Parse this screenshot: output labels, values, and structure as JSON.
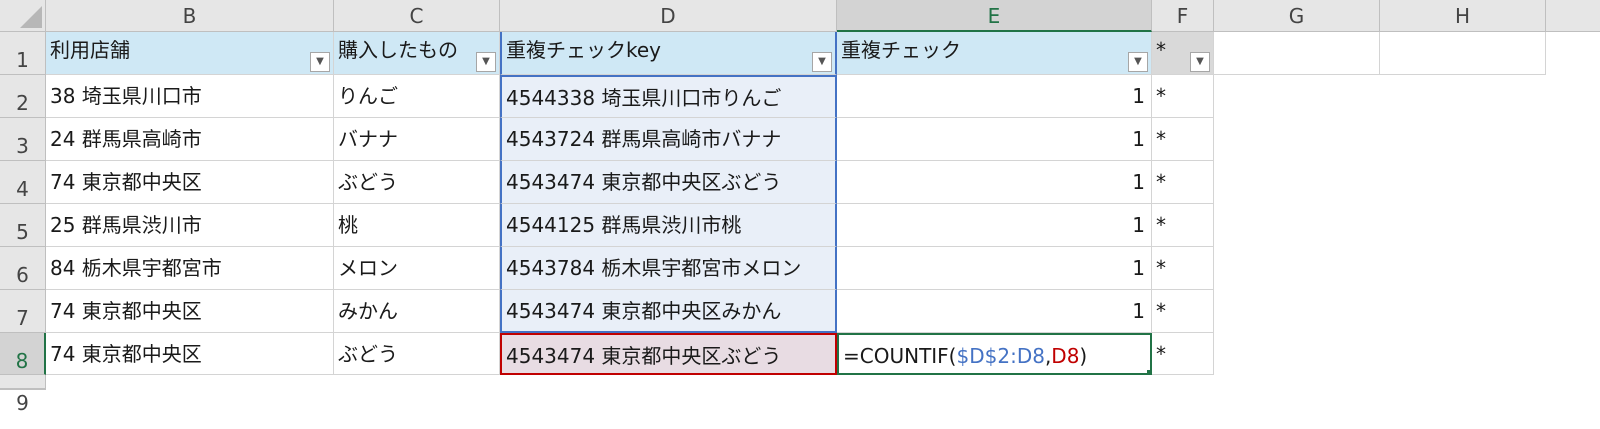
{
  "columns": [
    "B",
    "C",
    "D",
    "E",
    "F",
    "G",
    "H"
  ],
  "active_column": "E",
  "rows": [
    "1",
    "2",
    "3",
    "4",
    "5",
    "6",
    "7",
    "8",
    "9"
  ],
  "active_row": "8",
  "headers": {
    "b": "利用店舗",
    "c": "購入したもの",
    "d": "重複チェックkey",
    "e": "重複チェック",
    "f": "*"
  },
  "filter_icon": "filter-dropdown-icon",
  "data": [
    {
      "b": "38 埼玉県川口市",
      "c": "りんご",
      "d": "4544338 埼玉県川口市りんご",
      "e": "1",
      "f": "*"
    },
    {
      "b": "24 群馬県高崎市",
      "c": "バナナ",
      "d": "4543724 群馬県高崎市バナナ",
      "e": "1",
      "f": "*"
    },
    {
      "b": "74 東京都中央区",
      "c": "ぶどう",
      "d": "4543474 東京都中央区ぶどう",
      "e": "1",
      "f": "*"
    },
    {
      "b": "25 群馬県渋川市",
      "c": "桃",
      "d": "4544125 群馬県渋川市桃",
      "e": "1",
      "f": "*"
    },
    {
      "b": "84 栃木県宇都宮市",
      "c": "メロン",
      "d": "4543784 栃木県宇都宮市メロン",
      "e": "1",
      "f": "*"
    },
    {
      "b": "74 東京都中央区",
      "c": "みかん",
      "d": "4543474 東京都中央区みかん",
      "e": "1",
      "f": "*"
    },
    {
      "b": "74 東京都中央区",
      "c": "ぶどう",
      "d": "4543474 東京都中央区ぶどう",
      "f": "*"
    }
  ],
  "formula": {
    "prefix": "=COUNTIF(",
    "range": "$D$2:D8",
    "comma": ",",
    "ref": "D8",
    "suffix": ")"
  },
  "colors": {
    "header_fill": "#cfe8f5",
    "range_highlight": "#4472c4",
    "ref_highlight": "#c00000",
    "active": "#217346"
  }
}
